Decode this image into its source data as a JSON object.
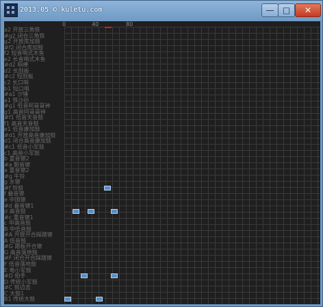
{
  "window": {
    "title": "2013.05 © kuletu.com",
    "minimize_glyph": "—",
    "maximize_glyph": "□",
    "close_glyph": "✕"
  },
  "ruler": {
    "ticks": [
      "0",
      "40",
      "80"
    ]
  },
  "rows": [
    {
      "note": "a2",
      "name": "开放三角铁"
    },
    {
      "note": "#g2",
      "name": "闭合三角铁"
    },
    {
      "note": "g2",
      "name": "开放库加鼓"
    },
    {
      "note": "#f2",
      "name": "闭合库加鼓"
    },
    {
      "note": "f2",
      "name": "短音哨式木鱼"
    },
    {
      "note": "e2",
      "name": "长音哨式木鱼"
    },
    {
      "note": "#d2",
      "name": "响棒"
    },
    {
      "note": "d2",
      "name": "长刮板"
    },
    {
      "note": "#c2",
      "name": "短刮板"
    },
    {
      "note": "c2",
      "name": "长口哨"
    },
    {
      "note": "b1",
      "name": "短口哨"
    },
    {
      "note": "#a1",
      "name": "沙锤"
    },
    {
      "note": "a1",
      "name": "铁沙砂"
    },
    {
      "note": "#g1",
      "name": "低音阿哥哥钟"
    },
    {
      "note": "g1",
      "name": "高音阿哥哥钟"
    },
    {
      "note": "#f1",
      "name": "低音天音鼓"
    },
    {
      "note": "f1",
      "name": "高音天音鼓"
    },
    {
      "note": "e1",
      "name": "低音康加鼓"
    },
    {
      "note": "#d1",
      "name": "开放高音康加鼓"
    },
    {
      "note": "d1",
      "name": "闭合高音康加鼓"
    },
    {
      "note": "#c1",
      "name": "低音小军鼓"
    },
    {
      "note": "c1",
      "name": "高音小军鼓"
    },
    {
      "note": "b",
      "name": "重音镲2"
    },
    {
      "note": "#a",
      "name": "颤音镲"
    },
    {
      "note": "a",
      "name": "重音镲2"
    },
    {
      "note": "#g",
      "name": "牛铃"
    },
    {
      "note": "g",
      "name": "水镲"
    },
    {
      "note": "#f",
      "name": "铃鼓"
    },
    {
      "note": "f",
      "name": "叠音镲"
    },
    {
      "note": "e",
      "name": "中国镲"
    },
    {
      "note": "#d",
      "name": "叠音镲1"
    },
    {
      "note": "d",
      "name": "高音鼓"
    },
    {
      "note": "#c",
      "name": "重音镲1"
    },
    {
      "note": "c",
      "name": "中高音鼓"
    },
    {
      "note": "B",
      "name": "中低音鼓"
    },
    {
      "note": "#A",
      "name": "开放开合踩踏镲"
    },
    {
      "note": "A",
      "name": "低音鼓"
    },
    {
      "note": "#G",
      "name": "踏板开合镲"
    },
    {
      "note": "G",
      "name": "高音落地鼓"
    },
    {
      "note": "#F",
      "name": "闭合开合踩踏镲"
    },
    {
      "note": "F",
      "name": "低音落地鼓"
    },
    {
      "note": "E",
      "name": "电小军鼓"
    },
    {
      "note": "#D",
      "name": "拍手"
    },
    {
      "note": "D",
      "name": "传统小军鼓"
    },
    {
      "note": "#C",
      "name": "鼓边击"
    },
    {
      "note": "C",
      "name": "大鼓1"
    },
    {
      "note": "B1",
      "name": "传统大鼓"
    }
  ],
  "notes": [
    {
      "row_note": "#f",
      "label": "铃鼓 hit 1"
    },
    {
      "row_note": "d",
      "label": "高音鼓 hit 1"
    },
    {
      "row_note": "d",
      "label": "高音鼓 hit 2"
    },
    {
      "row_note": "d",
      "label": "高音鼓 hit 3"
    },
    {
      "row_note": "#D",
      "label": "拍手 hit 1"
    },
    {
      "row_note": "#D",
      "label": "拍手 hit 2"
    },
    {
      "row_note": "B1",
      "label": "传统大鼓 hit 1"
    },
    {
      "row_note": "B1",
      "label": "传统大鼓 hit 2"
    }
  ]
}
